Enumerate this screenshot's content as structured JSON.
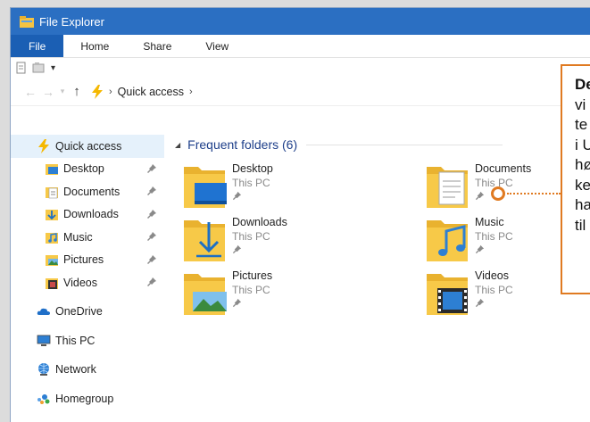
{
  "window": {
    "title": "File Explorer"
  },
  "ribbon": {
    "tabs": [
      "File",
      "Home",
      "Share",
      "View"
    ]
  },
  "address": {
    "crumbs": [
      "Quick access"
    ]
  },
  "sidebar": {
    "quick_access": "Quick access",
    "pinned": [
      {
        "label": "Desktop",
        "icon": "desktop-folder-icon"
      },
      {
        "label": "Documents",
        "icon": "documents-folder-icon"
      },
      {
        "label": "Downloads",
        "icon": "downloads-folder-icon"
      },
      {
        "label": "Music",
        "icon": "music-folder-icon"
      },
      {
        "label": "Pictures",
        "icon": "pictures-folder-icon"
      },
      {
        "label": "Videos",
        "icon": "videos-folder-icon"
      }
    ],
    "onedrive": "OneDrive",
    "thispc": "This PC",
    "network": "Network",
    "homegroup": "Homegroup"
  },
  "content": {
    "group_title": "Frequent folders (6)",
    "folders": [
      {
        "name": "Desktop",
        "location": "This PC"
      },
      {
        "name": "Documents",
        "location": "This PC"
      },
      {
        "name": "Downloads",
        "location": "This PC"
      },
      {
        "name": "Music",
        "location": "This PC"
      },
      {
        "name": "Pictures",
        "location": "This PC"
      },
      {
        "name": "Videos",
        "location": "This PC"
      }
    ]
  },
  "callout": {
    "lines": [
      "De",
      "vi",
      "te",
      "i U",
      "hø",
      "ke",
      "ha",
      "til"
    ]
  },
  "colors": {
    "accent": "#2b6fc2",
    "file_tab": "#1b5fb4",
    "callout": "#e07a21",
    "folder": "#f7c948"
  }
}
